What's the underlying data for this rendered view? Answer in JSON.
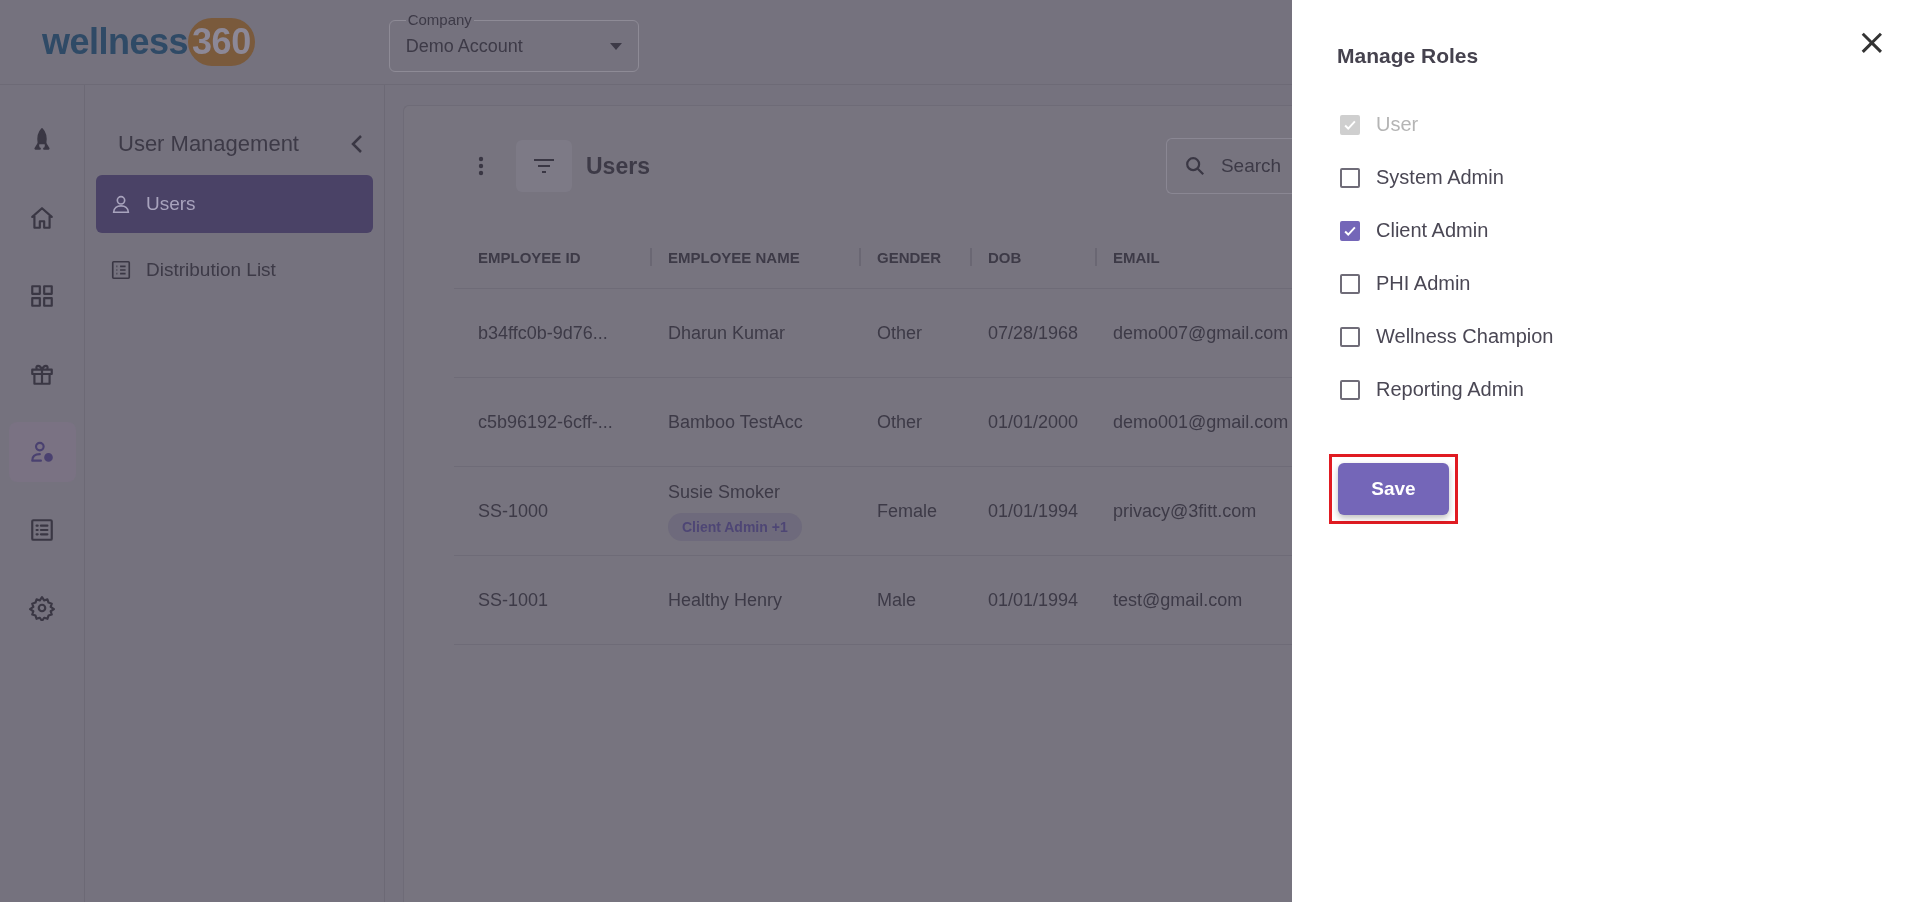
{
  "header": {
    "logo": {
      "word": "wellness",
      "number": "360"
    },
    "company": {
      "label": "Company",
      "value": "Demo Account"
    }
  },
  "rail": [
    {
      "kind": "rocket",
      "selected": false
    },
    {
      "kind": "home",
      "selected": false
    },
    {
      "kind": "grid",
      "selected": false
    },
    {
      "kind": "gift",
      "selected": false
    },
    {
      "kind": "user-gear",
      "selected": true
    },
    {
      "kind": "list",
      "selected": false
    },
    {
      "kind": "gear",
      "selected": false
    }
  ],
  "sidebar": {
    "title": "User Management",
    "items": [
      {
        "kind": "user",
        "label": "Users",
        "selected": true
      },
      {
        "kind": "list",
        "label": "Distribution List",
        "selected": false
      }
    ]
  },
  "toolbar": {
    "title": "Users",
    "search": {
      "placeholder": "Search"
    }
  },
  "table": {
    "columns": [
      "EMPLOYEE ID",
      "EMPLOYEE NAME",
      "GENDER",
      "DOB",
      "EMAIL"
    ],
    "rows": [
      {
        "cells": [
          "b34ffc0b-9d76...",
          "Dharun Kumar",
          "Other",
          "07/28/1968",
          "demo007@gmail.com"
        ]
      },
      {
        "cells": [
          "c5b96192-6cff-...",
          "Bamboo TestAcc",
          "Other",
          "01/01/2000",
          "demo001@gmail.com"
        ]
      },
      {
        "cells": [
          "SS-1000",
          "Susie Smoker",
          "Female",
          "01/01/1994",
          "privacy@3fitt.com"
        ],
        "badge": "Client Admin +1"
      },
      {
        "cells": [
          "SS-1001",
          "Healthy Henry",
          "Male",
          "01/01/1994",
          "test@gmail.com"
        ]
      }
    ]
  },
  "drawer": {
    "title": "Manage Roles",
    "close": "×",
    "roles": [
      {
        "label": "User",
        "checked": true,
        "disabled": true
      },
      {
        "label": "System Admin",
        "checked": false,
        "disabled": false
      },
      {
        "label": "Client Admin",
        "checked": true,
        "disabled": false
      },
      {
        "label": "PHI Admin",
        "checked": false,
        "disabled": false
      },
      {
        "label": "Wellness Champion",
        "checked": false,
        "disabled": false
      },
      {
        "label": "Reporting Admin",
        "checked": false,
        "disabled": false
      }
    ],
    "save": {
      "label": "Save",
      "highlighted": true
    }
  }
}
